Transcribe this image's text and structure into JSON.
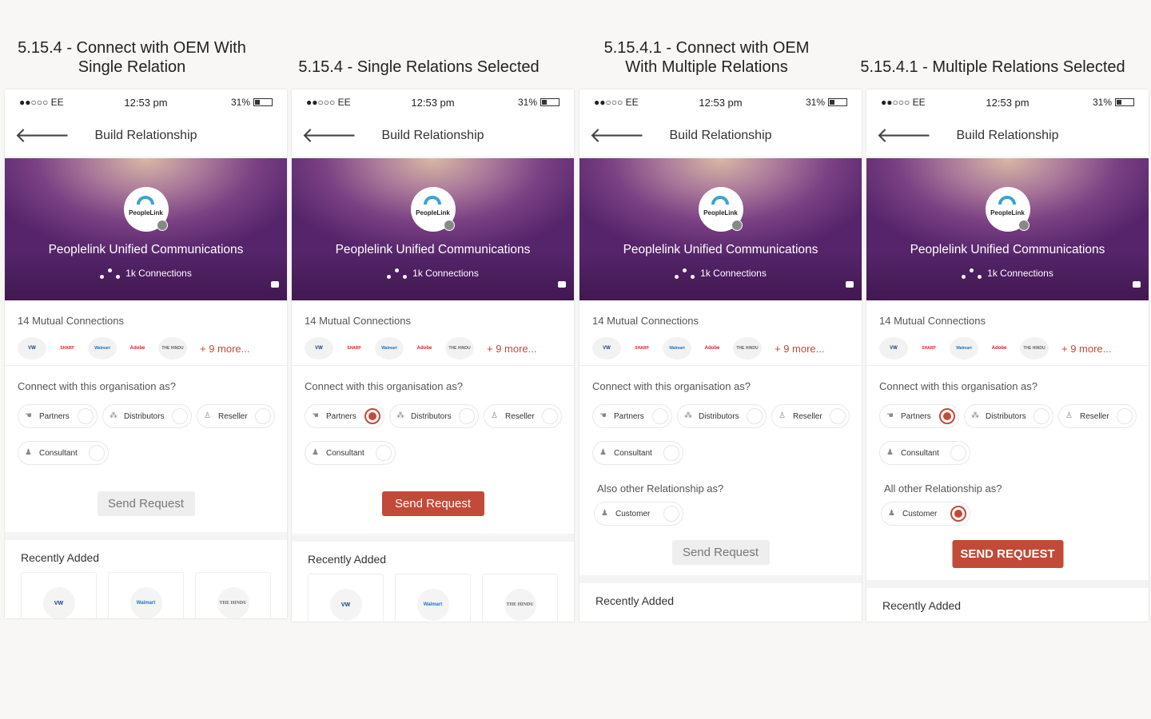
{
  "captions": [
    "5.15.4 - Connect with OEM With Single Relation",
    "5.15.4 - Single Relations Selected",
    "5.15.4.1 - Connect with OEM With Multiple Relations",
    "5.15.4.1 - Multiple Relations Selected"
  ],
  "status": {
    "carrier": "●●○○○ EE",
    "time": "12:53 pm",
    "battery": "31%"
  },
  "nav": {
    "back": "🡐",
    "title": "Build Relationship"
  },
  "org": {
    "logo_text": "PeopleLink",
    "name": "Peoplelink Unified Communications",
    "connections": "1k Connections"
  },
  "mutual": {
    "label": "14 Mutual Connections",
    "logos": [
      "Volkswagen",
      "SHARP",
      "Walmart",
      "Adobe",
      "THE HINDU"
    ],
    "more": "+ 9 more..."
  },
  "connect_question": "Connect with this organisation as?",
  "relations": [
    "Partners",
    "Distributors",
    "Reseller",
    "Consultant"
  ],
  "also_label": "Also other Relationship as?",
  "all_label": "All other Relationship as?",
  "customer": "Customer",
  "send_request": "Send Request",
  "send_request_caps": "SEND REQUEST",
  "recently_added": "Recently Added",
  "recent_logos": [
    "Volkswagen",
    "Walmart",
    "THE HINDU"
  ],
  "colors": {
    "accent": "#c24a38",
    "banner": "#5a2a6e"
  }
}
